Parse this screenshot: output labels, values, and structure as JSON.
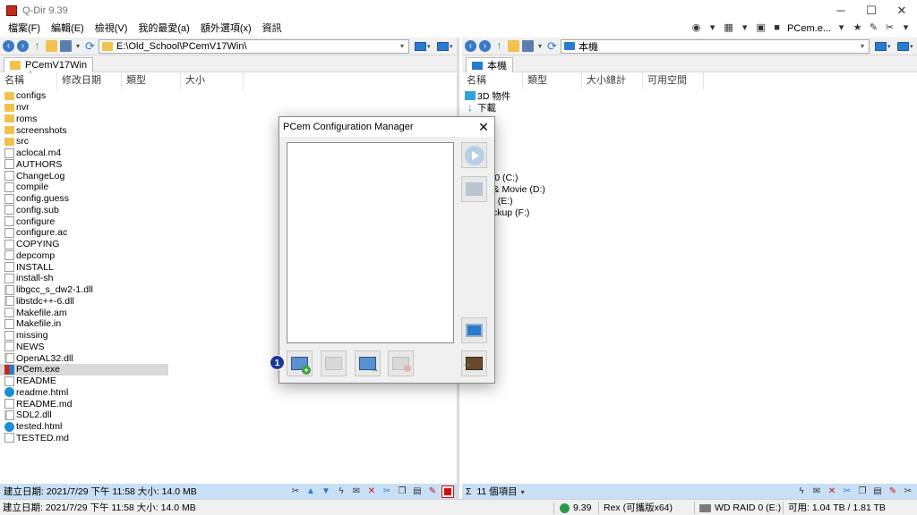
{
  "window": {
    "title": "Q-Dir 9.39"
  },
  "menu": {
    "items": [
      "檔案(F)",
      "編輯(E)",
      "檢視(V)",
      "我的最愛(a)",
      "額外選項(x)",
      "資訊"
    ],
    "pcem_label": "PCem.e..."
  },
  "left_pane": {
    "address": "E:\\Old_School\\PCemV17Win\\",
    "tab": "PCemV17Win",
    "columns": [
      "名稱",
      "修改日期",
      "類型",
      "大小"
    ],
    "files": [
      {
        "name": "configs",
        "type": "folder"
      },
      {
        "name": "nvr",
        "type": "folder"
      },
      {
        "name": "roms",
        "type": "folder"
      },
      {
        "name": "screenshots",
        "type": "folder"
      },
      {
        "name": "src",
        "type": "folder"
      },
      {
        "name": "aclocal.m4",
        "type": "file"
      },
      {
        "name": "AUTHORS",
        "type": "file"
      },
      {
        "name": "ChangeLog",
        "type": "file"
      },
      {
        "name": "compile",
        "type": "file"
      },
      {
        "name": "config.guess",
        "type": "file"
      },
      {
        "name": "config.sub",
        "type": "file"
      },
      {
        "name": "configure",
        "type": "file"
      },
      {
        "name": "configure.ac",
        "type": "file"
      },
      {
        "name": "COPYING",
        "type": "file"
      },
      {
        "name": "depcomp",
        "type": "file"
      },
      {
        "name": "INSTALL",
        "type": "file"
      },
      {
        "name": "install-sh",
        "type": "file"
      },
      {
        "name": "libgcc_s_dw2-1.dll",
        "type": "dll"
      },
      {
        "name": "libstdc++-6.dll",
        "type": "dll"
      },
      {
        "name": "Makefile.am",
        "type": "file"
      },
      {
        "name": "Makefile.in",
        "type": "file"
      },
      {
        "name": "missing",
        "type": "file"
      },
      {
        "name": "NEWS",
        "type": "file"
      },
      {
        "name": "OpenAL32.dll",
        "type": "dll"
      },
      {
        "name": "PCem.exe",
        "type": "exe",
        "selected": true
      },
      {
        "name": "README",
        "type": "file"
      },
      {
        "name": "readme.html",
        "type": "edge"
      },
      {
        "name": "README.md",
        "type": "file"
      },
      {
        "name": "SDL2.dll",
        "type": "dll"
      },
      {
        "name": "tested.html",
        "type": "edge"
      },
      {
        "name": "TESTED.md",
        "type": "file"
      }
    ],
    "status": "建立日期: 2021/7/29 下午 11:58 大小: 14.0 MB"
  },
  "right_pane": {
    "address": "本機",
    "tab": "本機",
    "columns": [
      "名稱",
      "類型",
      "大小總計",
      "可用空間"
    ],
    "top_items": [
      {
        "name": "3D 物件",
        "icon": "cube-icon"
      },
      {
        "name": "下載",
        "icon": "download-icon"
      }
    ],
    "drives": [
      "dows 10 (C:)",
      "nation & Movie (D:)",
      "RAID 0 (E:)",
      "ive_backup (F:)"
    ],
    "status": "11 個項目",
    "status_prefix": "Σ"
  },
  "bottom_status": {
    "left": "建立日期: 2021/7/29 下午 11:58 大小: 14.0 MB",
    "version": "9.39",
    "user": "Rex (可攜版x64)",
    "drive": "WD RAID 0 (E:)",
    "free": "可用: 1.04 TB / 1.81 TB"
  },
  "dialog": {
    "title": "PCem Configuration Manager",
    "close_glyph": "✕"
  },
  "badge": {
    "number": "1"
  }
}
